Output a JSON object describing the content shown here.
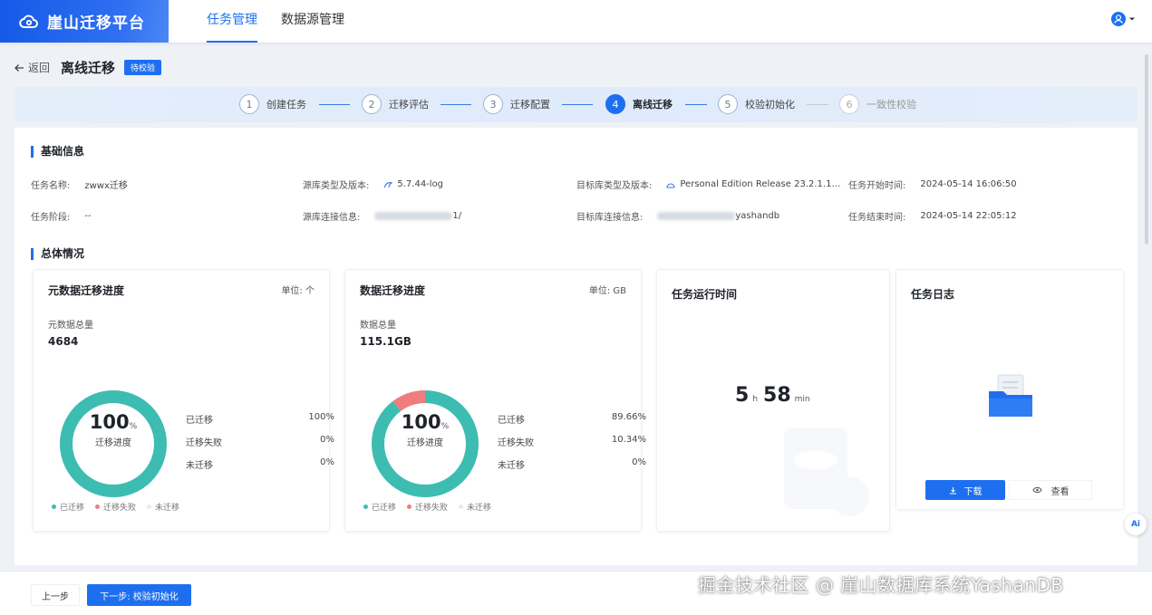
{
  "app": {
    "title": "崖山迁移平台"
  },
  "nav": {
    "tabs": [
      {
        "label": "任务管理"
      },
      {
        "label": "数据源管理"
      }
    ]
  },
  "header": {
    "back_label": "返回",
    "title": "离线迁移",
    "badge": "待校验"
  },
  "steps": [
    {
      "num": "1",
      "label": "创建任务"
    },
    {
      "num": "2",
      "label": "迁移评估"
    },
    {
      "num": "3",
      "label": "迁移配置"
    },
    {
      "num": "4",
      "label": "离线迁移"
    },
    {
      "num": "5",
      "label": "校验初始化"
    },
    {
      "num": "6",
      "label": "一致性校验"
    }
  ],
  "basic": {
    "section": "基础信息",
    "task_name_k": "任务名称:",
    "task_name_v": "zwwx迁移",
    "task_stage_k": "任务阶段:",
    "task_stage_v": "--",
    "src_type_k": "源库类型及版本:",
    "src_type_v": "5.7.44-log",
    "src_conn_k": "源库连接信息:",
    "src_conn_v": "1/",
    "dst_type_k": "目标库类型及版本:",
    "dst_type_v": "Personal Edition Release 23.2.1.1…",
    "dst_conn_k": "目标库连接信息:",
    "dst_conn_v": "yashandb",
    "start_k": "任务开始时间:",
    "start_v": "2024-05-14 16:06:50",
    "end_k": "任务结束时间:",
    "end_v": "2024-05-14 22:05:12"
  },
  "overview": {
    "section": "总体情况"
  },
  "meta_card": {
    "title": "元数据迁移进度",
    "unit": "单位: 个",
    "total_label": "元数据总量",
    "total": "4684",
    "center_num": "100",
    "center_pct": "%",
    "center_sub": "迁移进度",
    "rows": [
      {
        "k": "已迁移",
        "v": "100%"
      },
      {
        "k": "迁移失败",
        "v": "0%"
      },
      {
        "k": "未迁移",
        "v": "0%"
      }
    ],
    "legend": [
      "已迁移",
      "迁移失败",
      "未迁移"
    ],
    "migrated": 100,
    "failed": 0
  },
  "data_card": {
    "title": "数据迁移进度",
    "unit": "单位: GB",
    "total_label": "数据总量",
    "total": "115.1GB",
    "center_num": "100",
    "center_pct": "%",
    "center_sub": "迁移进度",
    "rows": [
      {
        "k": "已迁移",
        "v": "89.66%"
      },
      {
        "k": "迁移失败",
        "v": "10.34%"
      },
      {
        "k": "未迁移",
        "v": "0%"
      }
    ],
    "legend": [
      "已迁移",
      "迁移失败",
      "未迁移"
    ],
    "migrated": 89.66,
    "failed": 10.34
  },
  "runtime_card": {
    "title": "任务运行时间",
    "hours": "5",
    "h_unit": "h",
    "mins": "58",
    "m_unit": "min"
  },
  "log_card": {
    "title": "任务日志",
    "download": "下载",
    "view": "查看"
  },
  "footer": {
    "prev": "上一步",
    "next": "下一步: 校验初始化"
  },
  "watermark": "掘金技术社区 @ 崖山数据库系统YashanDB",
  "ai_fab": "Ai",
  "colors": {
    "accent": "#1e6ff0",
    "migrated": "#3dbcb2",
    "failed": "#ef7d7d",
    "pending": "#e8ebf0"
  }
}
